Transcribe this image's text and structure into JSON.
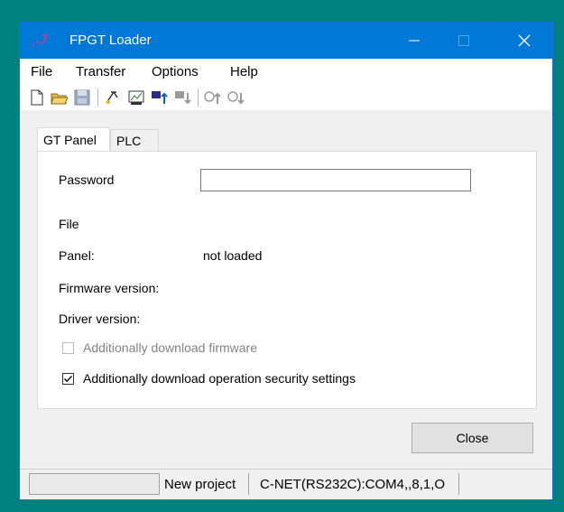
{
  "window": {
    "title": "FPGT Loader"
  },
  "titlebar_buttons": {
    "minimize": "—",
    "maximize": "☐",
    "close": "✕"
  },
  "menu": [
    "File",
    "Transfer",
    "Options",
    "Help"
  ],
  "toolbar": [
    "new-file-icon",
    "open-folder-icon",
    "save-icon",
    "settings-icon",
    "panel-icon",
    "download-icon",
    "upload-icon",
    "plc-download-icon",
    "plc-upload-icon"
  ],
  "tabs": {
    "active": "GT Panel",
    "other": "PLC"
  },
  "form": {
    "password_label": "Password",
    "password_value": "",
    "file_label": "File",
    "panel_label": "Panel:",
    "panel_value": "not loaded",
    "firmware_label": "Firmware version:",
    "driver_label": "Driver version:",
    "chk_firmware_label": "Additionally download firmware",
    "chk_firmware_checked": false,
    "chk_security_label": "Additionally download operation security settings",
    "chk_security_checked": true
  },
  "buttons": {
    "close": "Close"
  },
  "status": {
    "cell1": "",
    "project": "New project",
    "connection": "C-NET(RS232C):COM4,,8,1,O"
  },
  "colors": {
    "titlebar": "#0078d7",
    "desktop": "#00807f"
  }
}
